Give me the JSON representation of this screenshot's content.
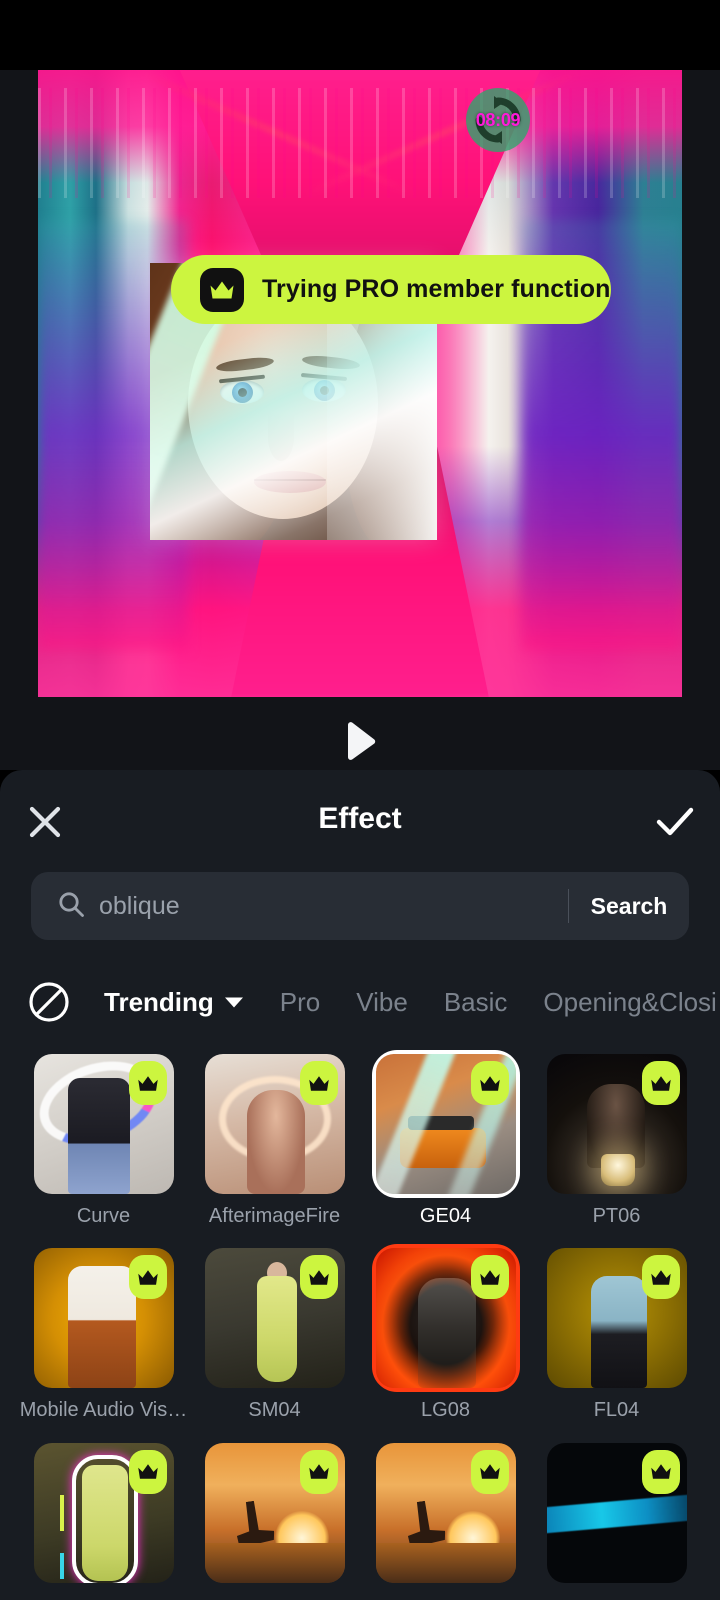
{
  "preview": {
    "pro_banner": {
      "text": "Trying PRO member function",
      "icon": "crown-icon",
      "bg_color": "#ccf53f"
    },
    "timer_badge": {
      "time": "08:09",
      "icon": "loop-refresh-icon",
      "ring_color": "#2ba86c",
      "text_color": "#ff1ad9"
    },
    "play_button": {
      "icon": "play-icon"
    }
  },
  "panel": {
    "title": "Effect",
    "close_icon": "close-icon",
    "confirm_icon": "check-icon",
    "search": {
      "value": "",
      "placeholder": "oblique",
      "icon": "search-icon",
      "button_label": "Search"
    },
    "tabs": {
      "none_icon": "no-effect-icon",
      "items": [
        {
          "label": "Trending",
          "active": true,
          "has_caret": true
        },
        {
          "label": "Pro",
          "active": false,
          "has_caret": false
        },
        {
          "label": "Vibe",
          "active": false,
          "has_caret": false
        },
        {
          "label": "Basic",
          "active": false,
          "has_caret": false
        },
        {
          "label": "Opening&Closi",
          "active": false,
          "has_caret": false
        }
      ]
    },
    "effects": [
      {
        "label": "Curve",
        "pro": true,
        "selected": false,
        "art": "t-curve"
      },
      {
        "label": "AfterimageFire",
        "pro": true,
        "selected": false,
        "art": "t-after"
      },
      {
        "label": "GE04",
        "pro": true,
        "selected": true,
        "art": "t-ge04"
      },
      {
        "label": "PT06",
        "pro": true,
        "selected": false,
        "art": "t-pt06"
      },
      {
        "label": "Mobile Audio Vis…",
        "pro": true,
        "selected": false,
        "art": "t-mobile"
      },
      {
        "label": "SM04",
        "pro": true,
        "selected": false,
        "art": "t-sm04"
      },
      {
        "label": "LG08",
        "pro": true,
        "selected": false,
        "art": "t-lg08"
      },
      {
        "label": "FL04",
        "pro": true,
        "selected": false,
        "art": "t-fl04"
      },
      {
        "label": "",
        "pro": true,
        "selected": false,
        "art": "t-neon"
      },
      {
        "label": "",
        "pro": true,
        "selected": false,
        "art": "t-surf"
      },
      {
        "label": "",
        "pro": true,
        "selected": false,
        "art": "t-surf"
      },
      {
        "label": "",
        "pro": true,
        "selected": false,
        "art": "t-blue"
      }
    ]
  },
  "colors": {
    "accent_lime": "#ccf53f",
    "panel_bg": "#181c22",
    "search_bg": "#282d35",
    "label_grey": "#9aa1ab",
    "selected_border": "#ffffff"
  }
}
